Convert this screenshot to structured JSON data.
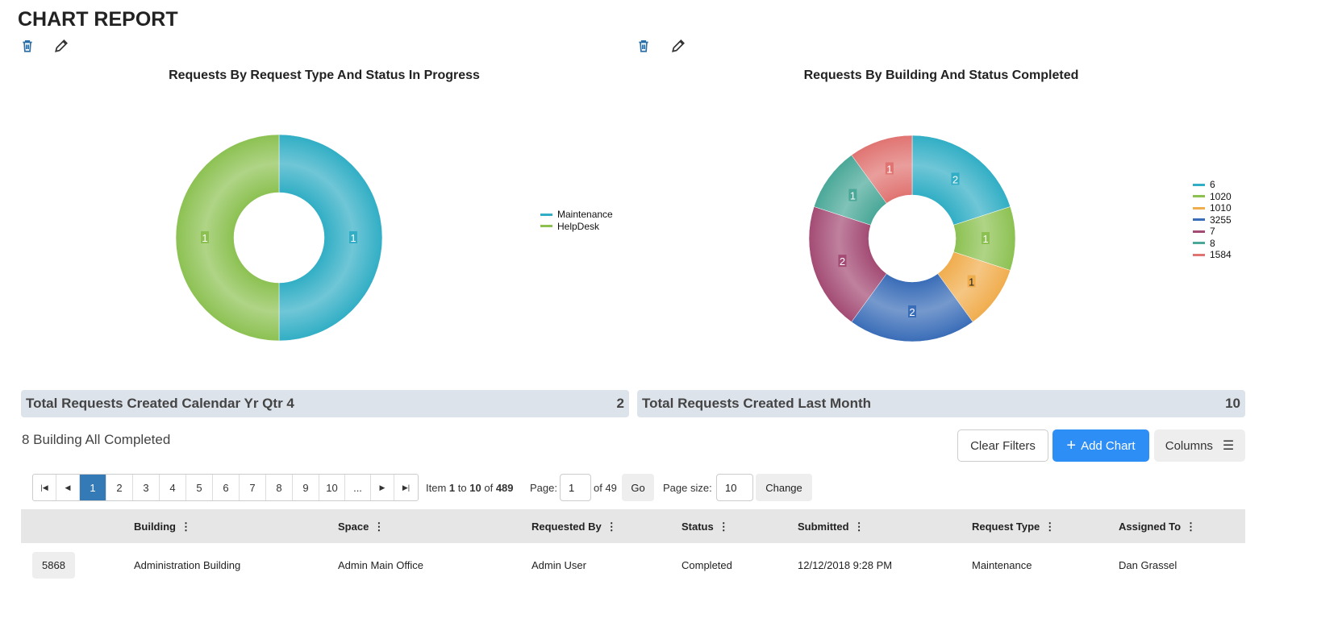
{
  "page": {
    "title": "CHART REPORT"
  },
  "icons": {
    "delete": "trash-icon",
    "edit": "pencil-icon"
  },
  "chart_data": [
    {
      "type": "pie",
      "donut": true,
      "title": "Requests By Request Type And Status In Progress",
      "labels": [
        "Maintenance",
        "HelpDesk"
      ],
      "values": [
        1,
        1
      ],
      "colors": [
        "#31aec5",
        "#8cc152"
      ],
      "legend": "right"
    },
    {
      "type": "pie",
      "donut": true,
      "title": "Requests By Building And Status Completed",
      "labels": [
        "6",
        "1020",
        "1010",
        "3255",
        "7",
        "8",
        "1584"
      ],
      "values": [
        2,
        1,
        1,
        2,
        2,
        1,
        1
      ],
      "colors": [
        "#31aec5",
        "#8cc152",
        "#f0ad4e",
        "#3a6db8",
        "#a34b74",
        "#4aa898",
        "#e07472"
      ],
      "legend": "right"
    }
  ],
  "kpis": [
    {
      "label": "Total Requests Created Calendar Yr Qtr 4",
      "value": "2"
    },
    {
      "label": "Total Requests Created Last Month",
      "value": "10"
    }
  ],
  "grid": {
    "title": "8 Building All Completed",
    "clear_filters": "Clear Filters",
    "add_chart": "Add Chart",
    "columns": "Columns",
    "pages": [
      "1",
      "2",
      "3",
      "4",
      "5",
      "6",
      "7",
      "8",
      "9",
      "10",
      "..."
    ],
    "item_prefix": "Item",
    "item_from": "1",
    "item_to_word": "to",
    "item_to": "10",
    "item_of_word": "of",
    "item_total": "489",
    "page_label": "Page:",
    "page_value": "1",
    "page_of": "of 49",
    "go": "Go",
    "page_size_label": "Page size:",
    "page_size": "10",
    "change": "Change",
    "headers": [
      "Building",
      "Space",
      "Requested By",
      "Status",
      "Submitted",
      "Request Type",
      "Assigned To"
    ],
    "rows": [
      {
        "id": "5868",
        "cells": [
          "Administration Building",
          "Admin Main Office",
          "Admin User",
          "Completed",
          "12/12/2018 9:28 PM",
          "Maintenance",
          "Dan Grassel"
        ]
      }
    ]
  }
}
